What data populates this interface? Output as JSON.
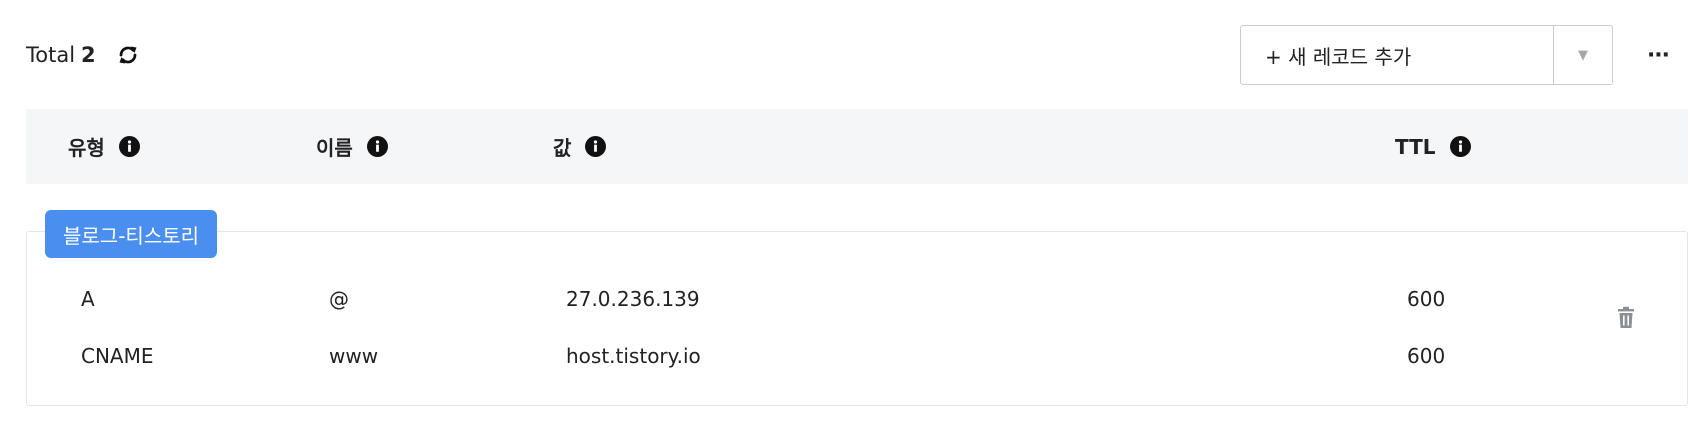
{
  "summary": {
    "total_label": "Total",
    "total_count": "2"
  },
  "icons": {
    "refresh": "refresh-icon",
    "info": "info-icon",
    "delete": "trash-icon",
    "more": "more-horizontal-icon",
    "caret": "caret-down-icon"
  },
  "toolbar": {
    "add_record_label": "+ 새 레코드 추가",
    "caret_glyph": "▼",
    "more_glyph": "⋯"
  },
  "columns": [
    {
      "label": "유형"
    },
    {
      "label": "이름"
    },
    {
      "label": "값"
    },
    {
      "label": "TTL"
    }
  ],
  "group": {
    "label": "블로그-티스토리",
    "records": [
      {
        "type": "A",
        "name": "@",
        "value": "27.0.236.139",
        "ttl": "600"
      },
      {
        "type": "CNAME",
        "name": "www",
        "value": "host.tistory.io",
        "ttl": "600"
      }
    ]
  },
  "colors": {
    "accent": "#4a8ef0",
    "header_bg": "#f5f6f8",
    "border": "#c9ccd1",
    "text": "#222222",
    "icon_muted": "#8a8f96"
  }
}
